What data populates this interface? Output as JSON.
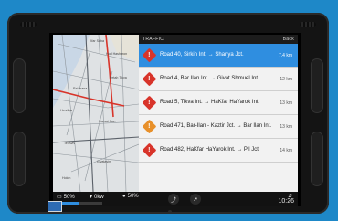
{
  "panel": {
    "title": "TRAFFIC",
    "back_label": "Back"
  },
  "traffic_items": [
    {
      "road": "Road 40, Sirkin Int. → Shariya Jct.",
      "distance": "7.4 km",
      "icon": "warning-diamond-red",
      "selected": true
    },
    {
      "road": "Road 4, Bar Ilan Int. → Givat Shmuel Int.",
      "distance": "12 km",
      "icon": "warning-diamond-red",
      "selected": false
    },
    {
      "road": "Road 5, Tikva Int. → HaKfar HaYarok Int.",
      "distance": "13 km",
      "icon": "warning-diamond-red",
      "selected": false
    },
    {
      "road": "Road 471, Bar-Ilan - Kaztir Jct. → Bar Ilan Int.",
      "distance": "13 km",
      "icon": "warning-diamond-orange",
      "selected": false
    },
    {
      "road": "Road 482, HaKfar HaYarok Int. → Pil Jct.",
      "distance": "14 km",
      "icon": "warning-diamond-red",
      "selected": false
    }
  ],
  "status": {
    "battery": "50%",
    "power": "0kw",
    "charge": "50%",
    "charge_progress_percent": 50,
    "time": "10:26"
  },
  "colors": {
    "accent": "#2f8ee0",
    "warning_red": "#d8342a",
    "warning_orange": "#e8902a",
    "background": "#1e88c8"
  }
}
